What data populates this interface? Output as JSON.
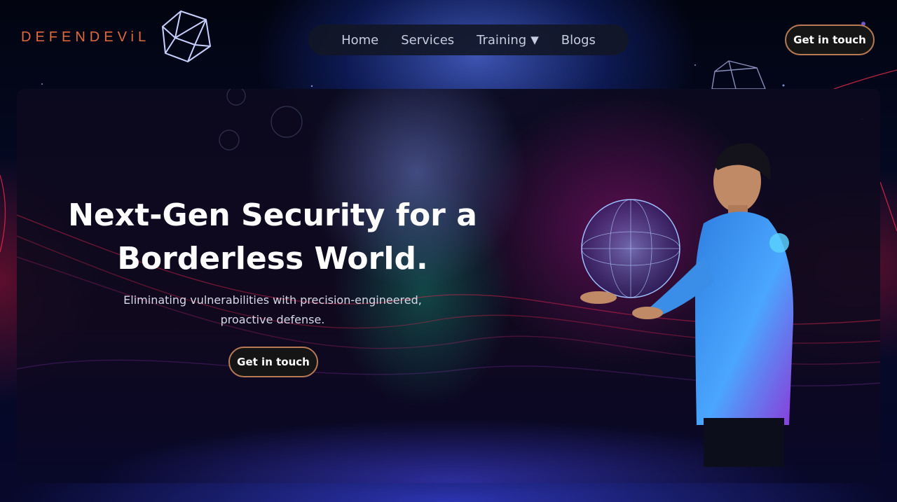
{
  "brand": {
    "name": "DEFENDEViL",
    "logo_icon": "geodesic-polyhedron-icon",
    "brand_color": "#e06a3c"
  },
  "nav": {
    "items": [
      {
        "label": "Home"
      },
      {
        "label": "Services"
      },
      {
        "label": "Training",
        "has_dropdown": true,
        "caret": "▼"
      },
      {
        "label": "Blogs"
      }
    ]
  },
  "header": {
    "cta_label": "Get in touch"
  },
  "hero": {
    "headline_line1": "Next-Gen Security for a",
    "headline_line2": "Borderless World.",
    "subtext_line1": "Eliminating vulnerabilities with precision-engineered,",
    "subtext_line2": "proactive defense.",
    "cta_label": "Get in touch",
    "image": "man-holding-holographic-globe"
  },
  "colors": {
    "accent_border": "#b77a55",
    "nav_bg": "#12162a",
    "text": "#ffffff"
  }
}
